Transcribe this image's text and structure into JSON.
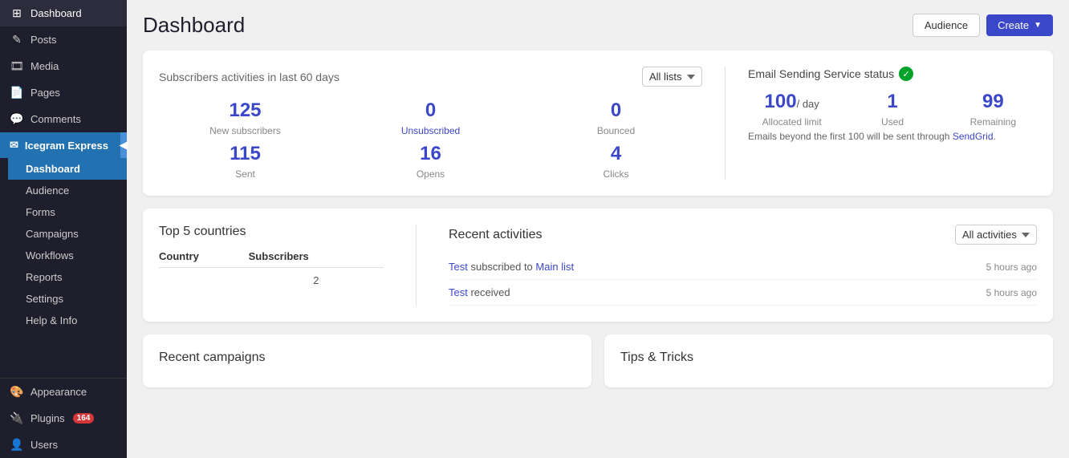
{
  "sidebar": {
    "logo_label": "Dashboard",
    "items": [
      {
        "id": "dashboard",
        "label": "Dashboard",
        "icon": "⊞"
      },
      {
        "id": "posts",
        "label": "Posts",
        "icon": "✏"
      },
      {
        "id": "media",
        "label": "Media",
        "icon": "🎞"
      },
      {
        "id": "pages",
        "label": "Pages",
        "icon": "📄"
      },
      {
        "id": "comments",
        "label": "Comments",
        "icon": "💬"
      }
    ],
    "icegram": {
      "label": "Icegram Express",
      "icon": "✉"
    },
    "sub_items": [
      {
        "id": "ig-dashboard",
        "label": "Dashboard",
        "active": true
      },
      {
        "id": "audience",
        "label": "Audience"
      },
      {
        "id": "forms",
        "label": "Forms"
      },
      {
        "id": "campaigns",
        "label": "Campaigns"
      },
      {
        "id": "workflows",
        "label": "Workflows"
      },
      {
        "id": "reports",
        "label": "Reports"
      },
      {
        "id": "settings",
        "label": "Settings"
      },
      {
        "id": "help",
        "label": "Help & Info"
      }
    ],
    "bottom_items": [
      {
        "id": "appearance",
        "label": "Appearance",
        "icon": "🎨"
      },
      {
        "id": "plugins",
        "label": "Plugins",
        "icon": "🔌",
        "badge": "164"
      },
      {
        "id": "users",
        "label": "Users",
        "icon": "👤"
      }
    ]
  },
  "header": {
    "title": "Dashboard",
    "audience_button": "Audience",
    "create_button": "Create"
  },
  "subscribers_card": {
    "title": "Subscribers activities in last 60 days",
    "dropdown_label": "All lists",
    "stats": [
      {
        "id": "new-subscribers",
        "value": "125",
        "label": "New subscribers"
      },
      {
        "id": "unsubscribed",
        "value": "0",
        "label": "Unsubscribed",
        "highlight": true
      },
      {
        "id": "bounced",
        "value": "0",
        "label": "Bounced"
      },
      {
        "id": "sent",
        "value": "115",
        "label": "Sent"
      },
      {
        "id": "opens",
        "value": "16",
        "label": "Opens"
      },
      {
        "id": "clicks",
        "value": "4",
        "label": "Clicks"
      }
    ]
  },
  "email_service": {
    "title": "Email Sending Service status",
    "status_icon": "✓",
    "stats": [
      {
        "id": "allocated",
        "value": "100",
        "per_day": "/ day",
        "label": "Allocated limit"
      },
      {
        "id": "used",
        "value": "1",
        "label": "Used"
      },
      {
        "id": "remaining",
        "value": "99",
        "label": "Remaining"
      }
    ],
    "note_prefix": "Emails beyond the first 100 will be sent through ",
    "note_link": "SendGrid",
    "note_suffix": "."
  },
  "countries": {
    "title": "Top 5 countries",
    "col_country": "Country",
    "col_subscribers": "Subscribers",
    "rows": [
      {
        "country": "",
        "subscribers": "2"
      }
    ]
  },
  "activities": {
    "title": "Recent activities",
    "dropdown_label": "All activities",
    "items": [
      {
        "id": "act1",
        "text_prefix": "",
        "link1_text": "Test",
        "middle_text": " subscribed to ",
        "link2_text": "Main list",
        "text_suffix": "",
        "time": "5 hours ago"
      },
      {
        "id": "act2",
        "text_prefix": "",
        "link1_text": "Test",
        "middle_text": " received",
        "link2_text": "",
        "text_suffix": "",
        "time": "5 hours ago"
      }
    ]
  },
  "bottom": {
    "recent_campaigns_title": "Recent campaigns",
    "tips_title": "Tips & Tricks"
  }
}
